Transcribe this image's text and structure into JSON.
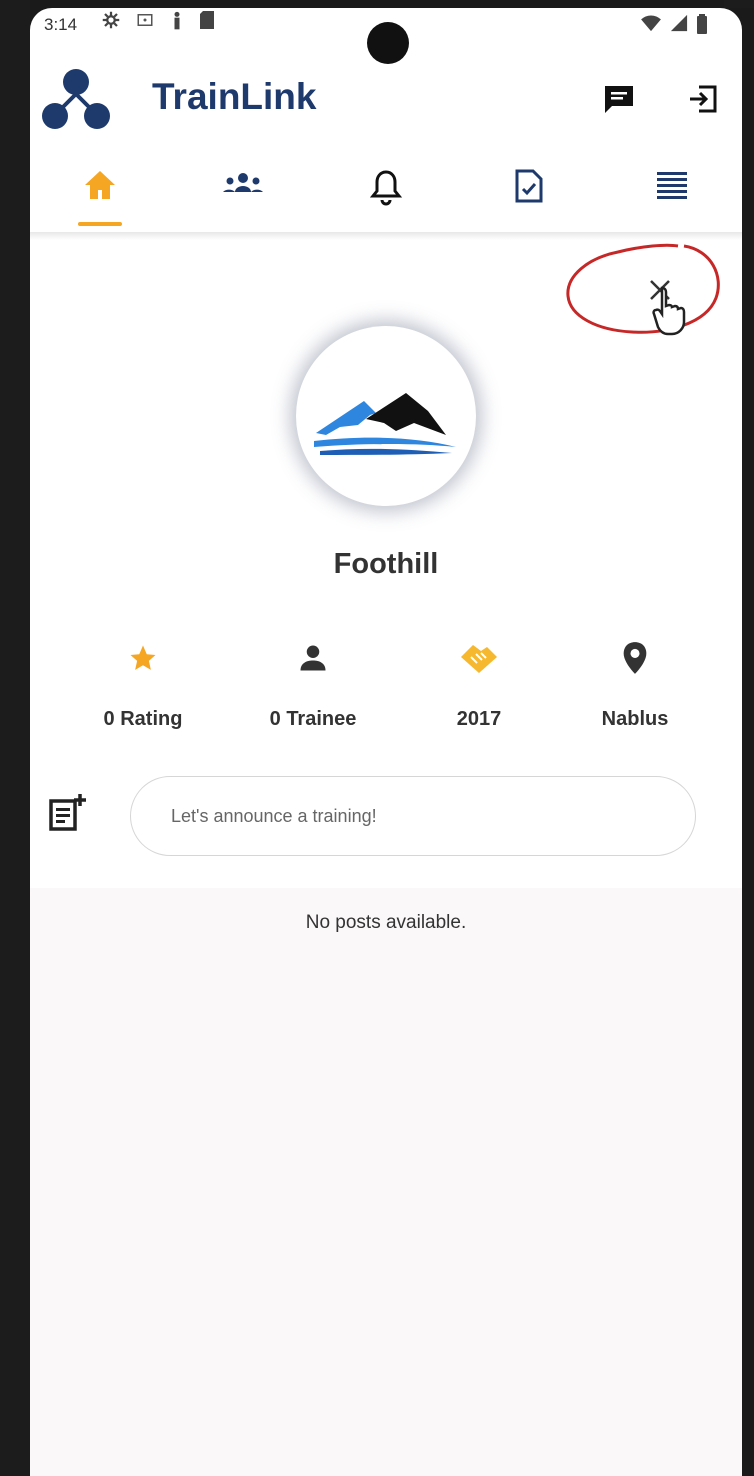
{
  "status_bar": {
    "time": "3:14"
  },
  "app": {
    "title": "TrainLink"
  },
  "header": {
    "icons": [
      "chat-icon",
      "logout-icon"
    ]
  },
  "tabs": [
    {
      "icon": "home-icon",
      "active": true
    },
    {
      "icon": "groups-icon",
      "active": false
    },
    {
      "icon": "bell-icon",
      "active": false
    },
    {
      "icon": "document-check-icon",
      "active": false
    },
    {
      "icon": "menu-icon",
      "active": false
    }
  ],
  "profile": {
    "name": "Foothill"
  },
  "stats": [
    {
      "icon": "star-icon",
      "label": "0 Rating",
      "color": "#f5a623"
    },
    {
      "icon": "person-icon",
      "label": "0 Trainee",
      "color": "#333333"
    },
    {
      "icon": "handshake-icon",
      "label": "2017",
      "color": "#f5b82e"
    },
    {
      "icon": "location-pin-icon",
      "label": "Nablus",
      "color": "#333333"
    }
  ],
  "composer": {
    "placeholder": "Let's announce a training!"
  },
  "feed": {
    "empty_message": "No posts available."
  },
  "colors": {
    "brand": "#1e3a6d",
    "accent": "#f5a623",
    "annotation": "#c62828"
  }
}
